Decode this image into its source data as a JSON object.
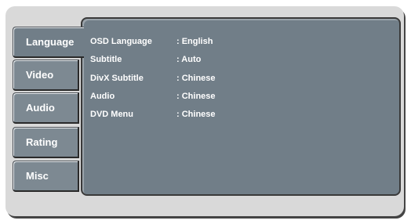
{
  "tabs": [
    {
      "label": "Language"
    },
    {
      "label": "Video"
    },
    {
      "label": "Audio"
    },
    {
      "label": "Rating"
    },
    {
      "label": "Misc"
    }
  ],
  "active_tab": "Language",
  "settings": [
    {
      "name": "OSD Language",
      "value": ": English"
    },
    {
      "name": "Subtitle",
      "value": ": Auto"
    },
    {
      "name": "DivX Subtitle",
      "value": ": Chinese"
    },
    {
      "name": "Audio",
      "value": ": Chinese"
    },
    {
      "name": "DVD Menu",
      "value": ": Chinese"
    }
  ],
  "colors": {
    "panel": "#717e88",
    "frame": "#d9d9d9",
    "text": "#ffffff"
  }
}
